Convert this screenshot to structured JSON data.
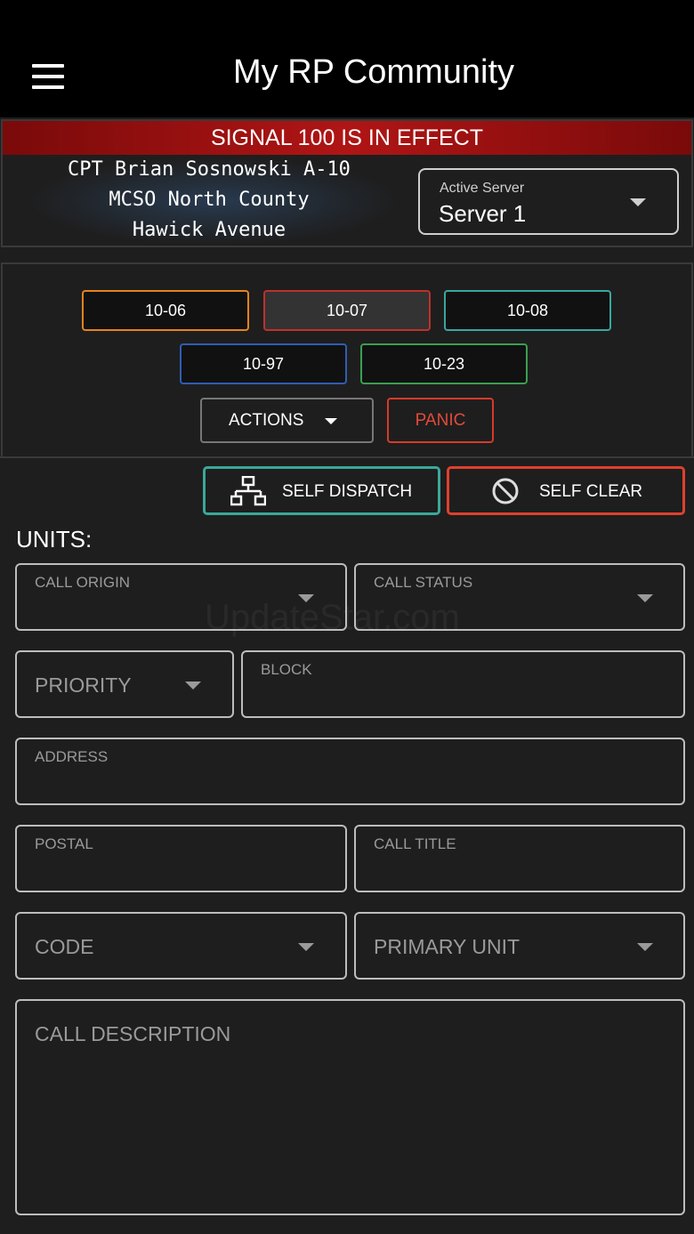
{
  "header": {
    "title": "My RP Community"
  },
  "banner": {
    "text": "SIGNAL 100 IS IN EFFECT"
  },
  "unit_info": {
    "line1": "CPT Brian Sosnowski A-10",
    "line2": "MCSO North County",
    "line3": "Hawick Avenue"
  },
  "server": {
    "label": "Active Server",
    "value": "Server 1"
  },
  "status_buttons": [
    {
      "label": "10-06",
      "color": "#e8821e"
    },
    {
      "label": "10-07",
      "color": "#c0302a"
    },
    {
      "label": "10-08",
      "color": "#36a8a0"
    },
    {
      "label": "10-97",
      "color": "#2f5db5"
    },
    {
      "label": "10-23",
      "color": "#3aa050"
    }
  ],
  "actions": {
    "label": "ACTIONS"
  },
  "panic": {
    "label": "PANIC"
  },
  "self_dispatch": {
    "label": "SELF DISPATCH"
  },
  "self_clear": {
    "label": "SELF CLEAR"
  },
  "units": {
    "label": "UNITS:"
  },
  "form": {
    "call_origin": "CALL ORIGIN",
    "call_status": "CALL STATUS",
    "priority": "PRIORITY",
    "block": "BLOCK",
    "address": "ADDRESS",
    "postal": "POSTAL",
    "call_title": "CALL TITLE",
    "code": "CODE",
    "primary_unit": "PRIMARY UNIT",
    "call_description": "CALL DESCRIPTION"
  },
  "watermark": "UpdateStar.com"
}
